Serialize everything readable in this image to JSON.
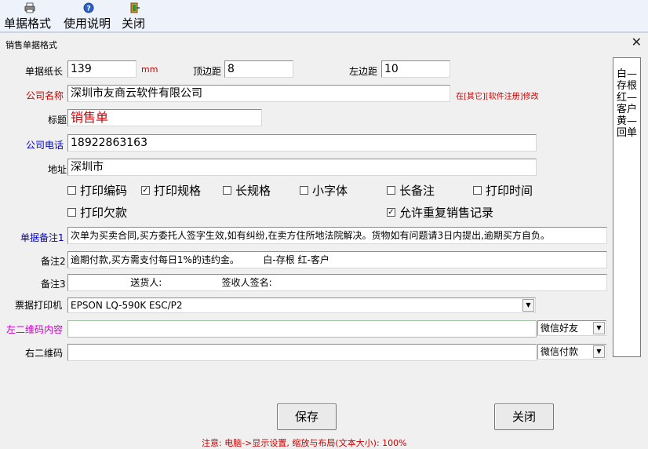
{
  "menu": {
    "items": [
      {
        "label": "单据格式",
        "icon": "printer-icon"
      },
      {
        "label": "使用说明",
        "icon": "help-icon"
      },
      {
        "label": "关闭",
        "icon": "exit-door-icon"
      }
    ]
  },
  "dialog": {
    "title": "销售单据格式",
    "close_glyph": "✕"
  },
  "form": {
    "paper_length": {
      "label": "单据纸长",
      "value": "139",
      "unit": "mm"
    },
    "top_margin": {
      "label": "顶边距",
      "value": "8"
    },
    "left_margin": {
      "label": "左边距",
      "value": "10"
    },
    "company_name": {
      "label": "公司名称",
      "value": "深圳市友商云软件有限公司",
      "hint": "在[其它][软件注册]修改"
    },
    "title": {
      "label": "标题",
      "value": "销售单"
    },
    "phone": {
      "label": "公司电话",
      "value": "18922863163"
    },
    "address": {
      "label": "地址",
      "value": "深圳市"
    },
    "checkboxes": [
      {
        "label": "打印编码",
        "checked": false
      },
      {
        "label": "打印规格",
        "checked": true
      },
      {
        "label": "长规格",
        "checked": false
      },
      {
        "label": "小字体",
        "checked": false
      },
      {
        "label": "长备注",
        "checked": false
      },
      {
        "label": "打印时间",
        "checked": false
      },
      {
        "label": "打印欠款",
        "checked": false
      },
      {
        "label": "允许重复销售记录",
        "checked": true
      }
    ],
    "note1": {
      "label": "单据备注1",
      "value": "次单为买卖合同,买方委托人签字生效,如有纠纷,在卖方住所地法院解决。货物如有问题请3日内提出,逾期买方自负。"
    },
    "note2": {
      "label": "备注2",
      "value": "逾期付款,买方需支付每日1%的违约金。        白-存根 红-客户"
    },
    "note3": {
      "label": "备注3",
      "value": "                    送货人:                    签收人签名:"
    },
    "printer": {
      "label": "票据打印机",
      "value": "EPSON LQ-590K ESC/P2"
    },
    "qr_left": {
      "label": "左二维码内容",
      "value": "",
      "option": "微信好友"
    },
    "qr_right": {
      "label": "右二维码",
      "value": "",
      "option": "微信付款"
    }
  },
  "side_panel": {
    "text": "白—存根 红—客户 黄—回单"
  },
  "buttons": {
    "save": "保存",
    "close": "关闭"
  },
  "note": "注意: 电脑->显示设置, 缩放与布局(文本大小): 100%",
  "colors": {
    "label_red": "#cc0000",
    "label_blue": "#0000cc",
    "label_magenta": "#cc00cc",
    "title_red": "#d40000"
  }
}
